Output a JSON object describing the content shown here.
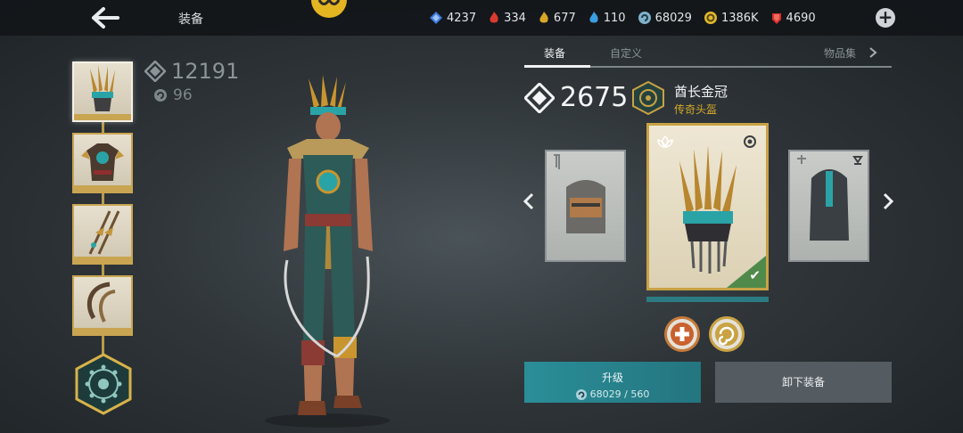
{
  "header": {
    "title": "装备",
    "currencies": [
      {
        "icon": "blue-crystal-icon",
        "value": "4237",
        "color": "#3f7be0"
      },
      {
        "icon": "red-flame-icon",
        "value": "334",
        "color": "#d83b2f"
      },
      {
        "icon": "gold-flame-icon",
        "value": "677",
        "color": "#d9a628"
      },
      {
        "icon": "blue-flame-icon",
        "value": "110",
        "color": "#3c9de0"
      },
      {
        "icon": "spiral-coin-icon",
        "value": "68029",
        "color": "#7fb1c8"
      },
      {
        "icon": "gold-coin-icon",
        "value": "1386K",
        "color": "#e0b92e"
      },
      {
        "icon": "ruby-icon",
        "value": "4690",
        "color": "#d8302c"
      }
    ]
  },
  "left": {
    "power": "12191",
    "level": "96"
  },
  "tabs": {
    "equipment": "装备",
    "custom": "自定义",
    "sets": "物品集"
  },
  "item": {
    "power": "2675",
    "name": "酋长金冠",
    "rarity": "传奇头盔",
    "rarity_color": "#d4a92b"
  },
  "actions": {
    "upgrade_label": "升级",
    "upgrade_cost": "68029 / 560",
    "unequip_label": "卸下装备"
  }
}
